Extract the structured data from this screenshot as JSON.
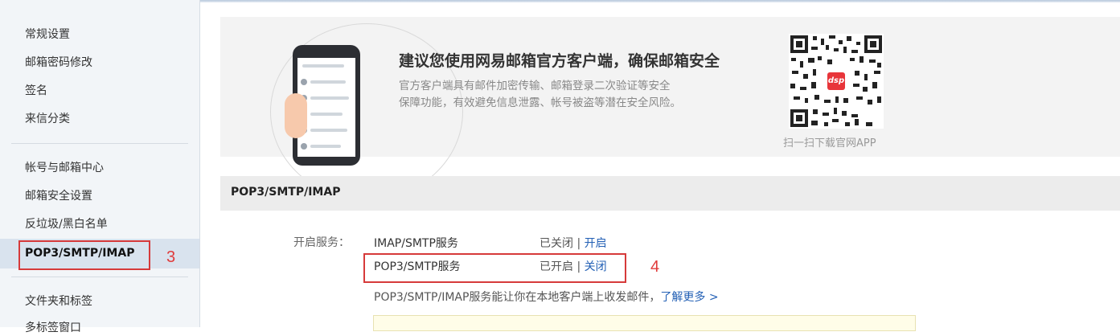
{
  "sidebar": {
    "items": [
      {
        "label": "常规设置"
      },
      {
        "label": "邮箱密码修改"
      },
      {
        "label": "签名"
      },
      {
        "label": "来信分类"
      },
      {
        "label": "帐号与邮箱中心"
      },
      {
        "label": "邮箱安全设置"
      },
      {
        "label": "反垃圾/黑白名单"
      },
      {
        "label": "POP3/SMTP/IMAP"
      },
      {
        "label": "文件夹和标签"
      },
      {
        "label": "多标签窗口"
      }
    ],
    "active_index": 7,
    "annotation": "3"
  },
  "banner": {
    "title": "建议您使用网易邮箱官方客户端，确保邮箱安全",
    "desc_line1": "官方客户端具有邮件加密传输、邮箱登录二次验证等安全",
    "desc_line2": "保障功能，有效避免信息泄露、帐号被盗等潜在安全风险。",
    "qr_logo": "dsp",
    "qr_caption": "扫一扫下载官网APP"
  },
  "section": {
    "title": "POP3/SMTP/IMAP",
    "service_label": "开启服务：",
    "services": [
      {
        "name": "IMAP/SMTP服务",
        "state": "已关闭",
        "sep": " | ",
        "action": "开启"
      },
      {
        "name": "POP3/SMTP服务",
        "state": "已开启",
        "sep": " | ",
        "action": "关闭"
      }
    ],
    "annotation": "4",
    "hint_text": "POP3/SMTP/IMAP服务能让你在本地客户端上收发邮件，",
    "hint_link": "了解更多 >"
  },
  "colors": {
    "accent_link": "#2360b5",
    "annotation_red": "#d63a3a",
    "sidebar_bg": "#f2f5f8",
    "sidebar_active_bg": "#d9e3ee"
  }
}
